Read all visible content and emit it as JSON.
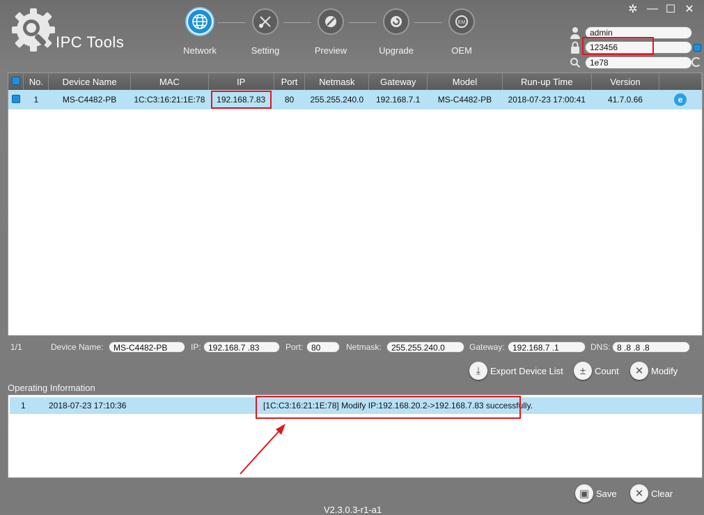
{
  "app": {
    "title": "IPC Tools",
    "version": "V2.3.0.3-r1-a1"
  },
  "nav": [
    {
      "label": "Network",
      "active": true
    },
    {
      "label": "Setting",
      "active": false
    },
    {
      "label": "Preview",
      "active": false
    },
    {
      "label": "Upgrade",
      "active": false
    },
    {
      "label": "OEM",
      "active": false
    }
  ],
  "login": {
    "username": "admin",
    "password": "123456",
    "search": "1e78"
  },
  "table": {
    "headers": [
      "No.",
      "Device Name",
      "MAC",
      "IP",
      "Port",
      "Netmask",
      "Gateway",
      "Model",
      "Run-up Time",
      "Version"
    ],
    "rows": [
      {
        "no": "1",
        "device_name": "MS-C4482-PB",
        "mac": "1C:C3:16:21:1E:78",
        "ip": "192.168.7.83",
        "port": "80",
        "netmask": "255.255.240.0",
        "gateway": "192.168.7.1",
        "model": "MS-C4482-PB",
        "runup": "2018-07-23 17:00:41",
        "version": "41.7.0.66"
      }
    ]
  },
  "detail": {
    "page": "1/1",
    "device_name_label": "Device Name:",
    "device_name": "MS-C4482-PB",
    "ip_label": "IP:",
    "ip": "192.168.7  .83",
    "port_label": "Port:",
    "port": "80",
    "netmask_label": "Netmask:",
    "netmask": "255.255.240.0",
    "gateway_label": "Gateway:",
    "gateway": "192.168.7  .1",
    "dns_label": "DNS:",
    "dns": "8  .8  .8  .8"
  },
  "actions": {
    "export": "Export Device List",
    "count": "Count",
    "modify": "Modify"
  },
  "log": {
    "title": "Operating Information",
    "rows": [
      {
        "no": "1",
        "time": "2018-07-23 17:10:36",
        "message": "[1C:C3:16:21:1E:78] Modify  IP:192.168.20.2->192.168.7.83 successfully."
      }
    ]
  },
  "footer": {
    "save": "Save",
    "clear": "Clear"
  },
  "colors": {
    "accent": "#1d8fd6",
    "selection": "#b7e1f5",
    "annotation": "#e1161c"
  }
}
